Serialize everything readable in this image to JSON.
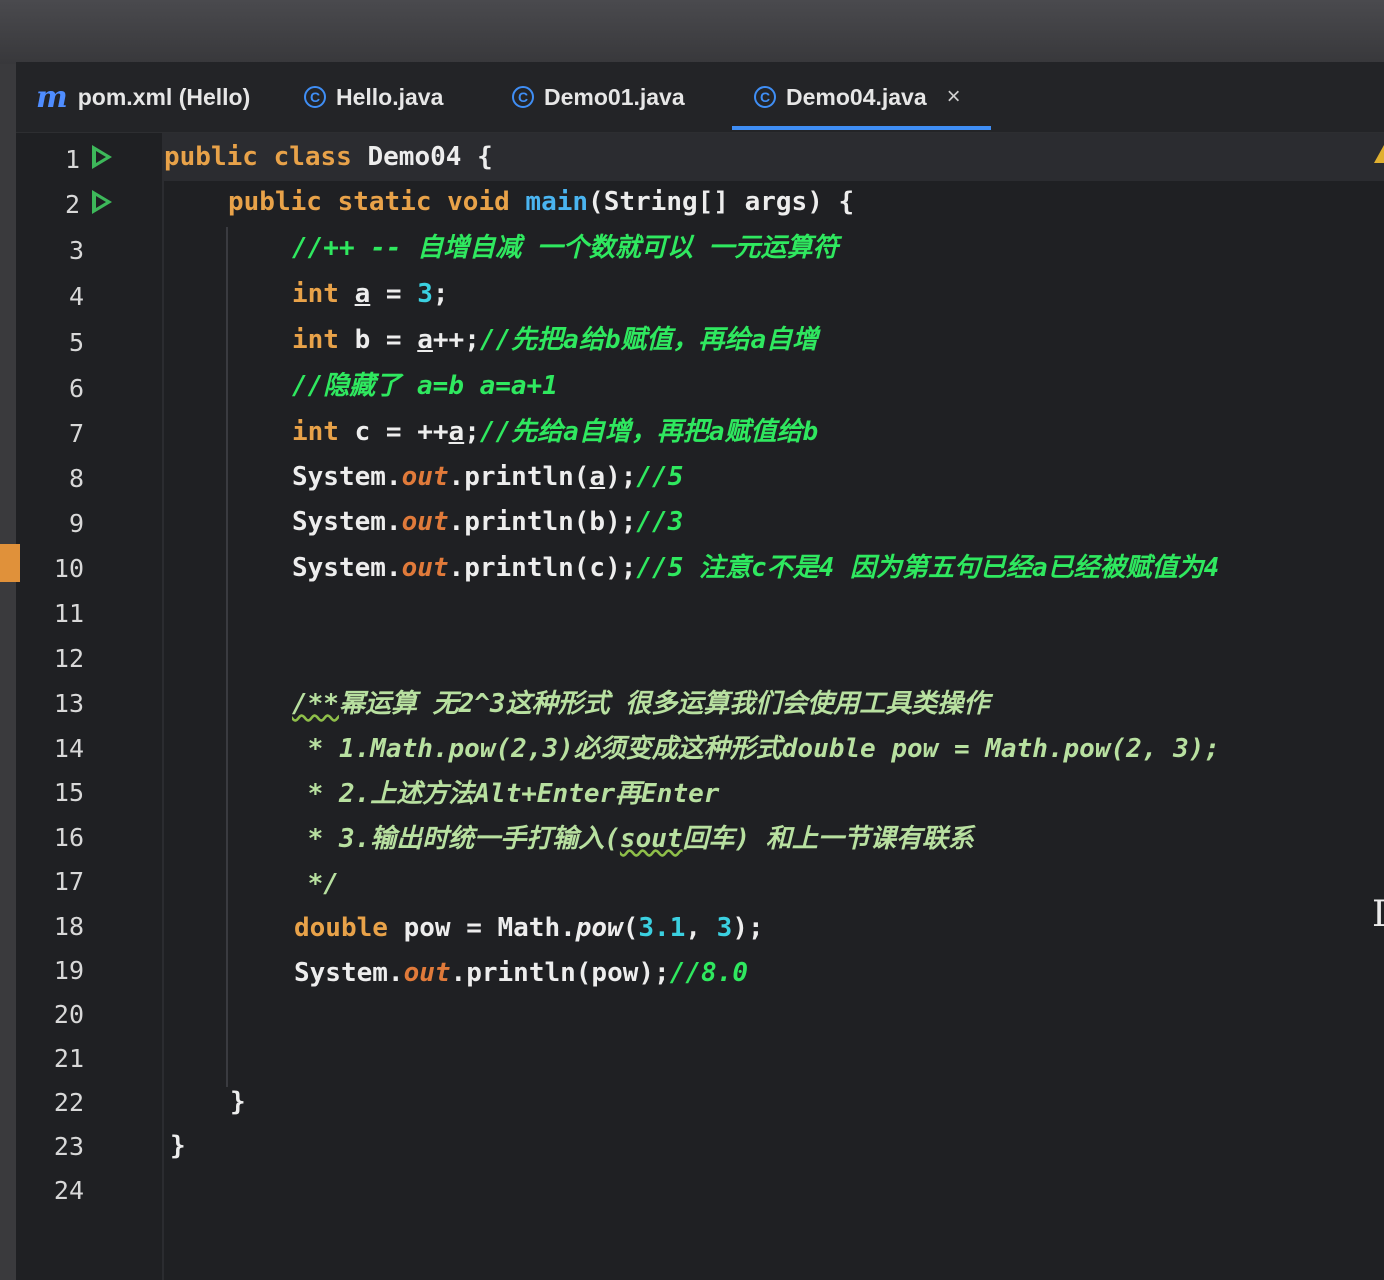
{
  "tabs": [
    {
      "icon": "maven-icon",
      "label": "pom.xml (Hello)"
    },
    {
      "icon": "java-class-icon",
      "label": "Hello.java"
    },
    {
      "icon": "java-class-icon",
      "label": "Demo01.java"
    },
    {
      "icon": "java-class-icon",
      "label": "Demo04.java",
      "active": true,
      "close": "×"
    }
  ],
  "colors": {
    "keyword": "#e8a249",
    "method": "#4ab4f0",
    "number": "#3bd0e0",
    "comment": "#2fe85f",
    "field": "#e07a3a",
    "tab_active": "#3f8ef5"
  },
  "editor": {
    "line_numbers": [
      "1",
      "2",
      "3",
      "4",
      "5",
      "6",
      "7",
      "8",
      "9",
      "10",
      "11",
      "12",
      "13",
      "14",
      "15",
      "16",
      "17",
      "18",
      "19",
      "20",
      "21",
      "22",
      "23",
      "24"
    ],
    "lines": {
      "l1": {
        "a": "public class ",
        "b": "Demo04 {"
      },
      "l2": {
        "a": "public static void ",
        "b": "main",
        "c": "(String[] args) {"
      },
      "l3": {
        "cm": "//++ -- 自增自减 一个数就可以 一元运算符"
      },
      "l4": {
        "kw": "int ",
        "v": "a",
        "eq": " = ",
        "num": "3",
        "end": ";"
      },
      "l5": {
        "kw": "int ",
        "t": "b = ",
        "v": "a",
        "t2": "++;",
        "cm": "//先把a给b赋值，再给a自增"
      },
      "l6": {
        "cm": "//隐藏了 a=b a=a+1"
      },
      "l7": {
        "kw": "int ",
        "t": "c = ++",
        "v": "a",
        "t2": ";",
        "cm": "//先给a自增，再把a赋值给b"
      },
      "l8": {
        "t": "System.",
        "fld": "out",
        "t2": ".println(",
        "v": "a",
        "t3": ");",
        "cm": "//5"
      },
      "l9": {
        "t": "System.",
        "fld": "out",
        "t2": ".println(b);",
        "cm": "//3"
      },
      "l10": {
        "t": "System.",
        "fld": "out",
        "t2": ".println(c);",
        "cm": "//5 注意c不是4 因为第五句已经a已经被赋值为4"
      },
      "l13": {
        "open": "/**",
        "text": "幂运算 无2^3这种形式 很多运算我们会使用工具类操作"
      },
      "l14": {
        "text": " * 1.Math.pow(2,3)必须变成这种形式double pow = Math.pow(2, 3);"
      },
      "l15": {
        "text": " * 2.上述方法Alt+Enter再Enter"
      },
      "l16": {
        "a": " * 3.输出时统一手打输入(",
        "u": "sout",
        "b": "回车) 和上一节课有联系"
      },
      "l17": {
        "text": " */"
      },
      "l18": {
        "kw": "double ",
        "t": "pow = Math.",
        "m": "pow",
        "t2": "(",
        "n1": "3.1",
        "t3": ", ",
        "n2": "3",
        "t4": ");"
      },
      "l19": {
        "t": "System.",
        "fld": "out",
        "t2": ".println(pow);",
        "cm": "//8.0"
      },
      "l22": {
        "text": "}"
      },
      "l23": {
        "text": "}"
      }
    }
  }
}
